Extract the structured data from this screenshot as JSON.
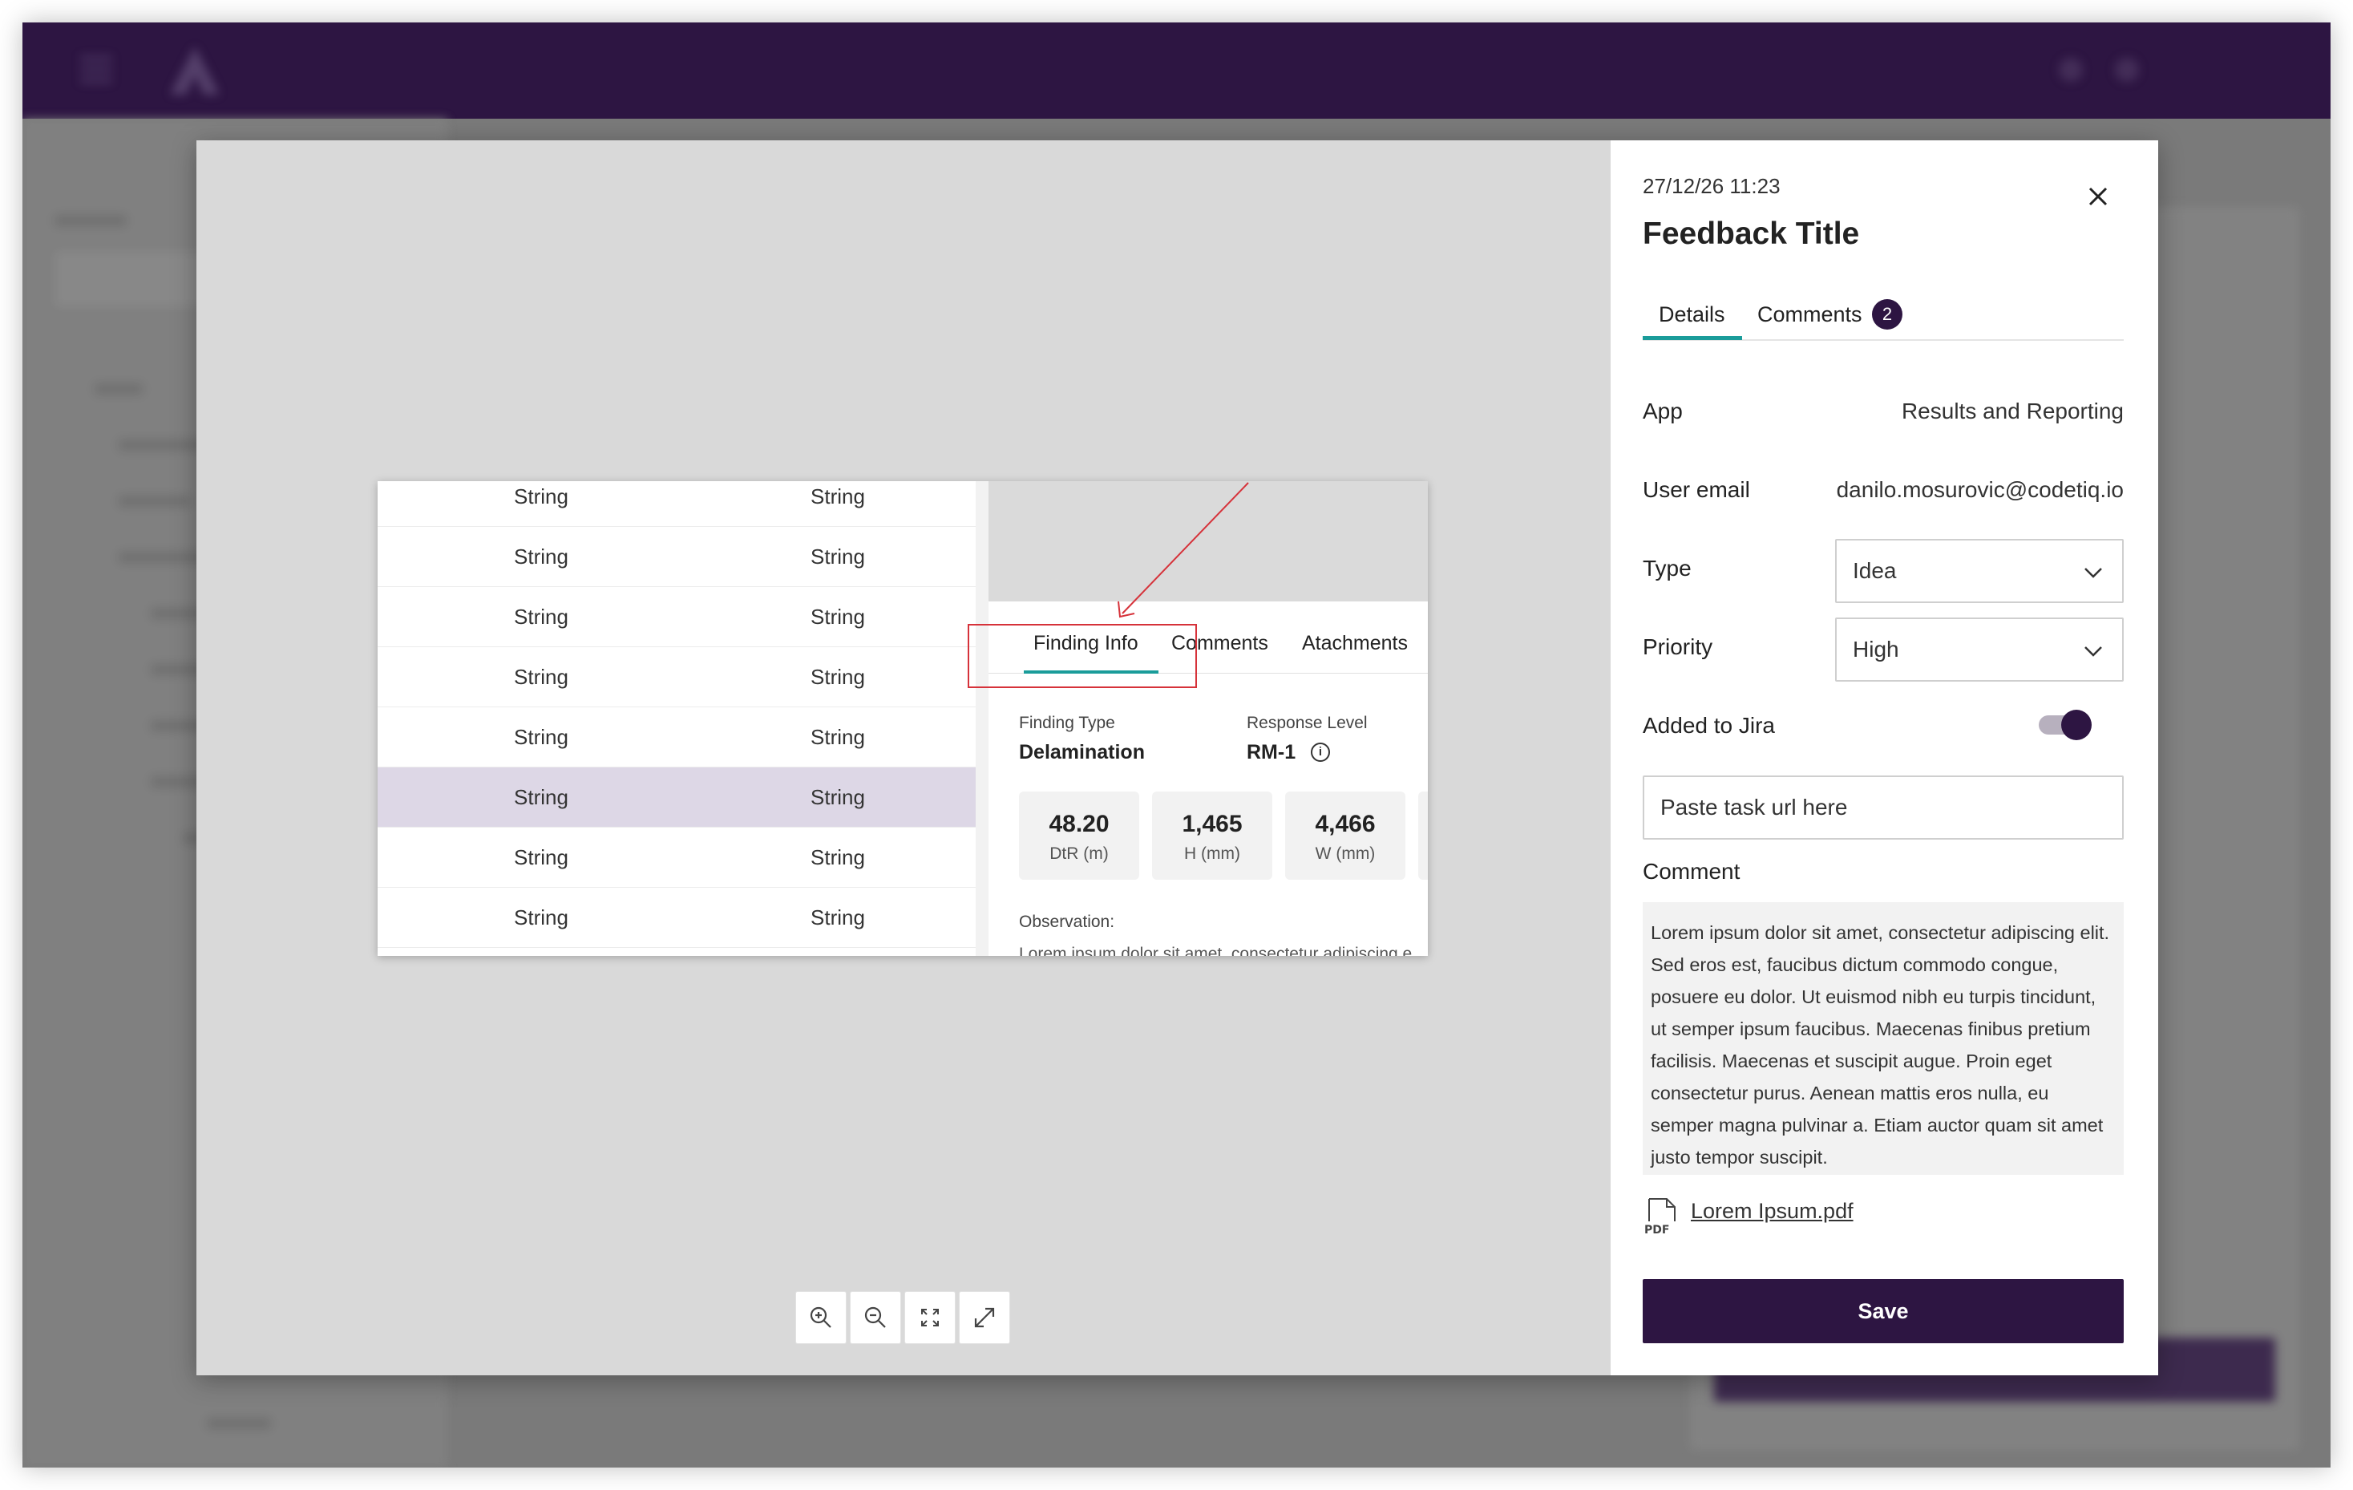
{
  "preview": {
    "rows": [
      {
        "c1": "String",
        "c2": "String",
        "selected": false
      },
      {
        "c1": "String",
        "c2": "String",
        "selected": false
      },
      {
        "c1": "String",
        "c2": "String",
        "selected": false
      },
      {
        "c1": "String",
        "c2": "String",
        "selected": false
      },
      {
        "c1": "String",
        "c2": "String",
        "selected": false
      },
      {
        "c1": "String",
        "c2": "String",
        "selected": true
      },
      {
        "c1": "String",
        "c2": "String",
        "selected": false
      },
      {
        "c1": "String",
        "c2": "String",
        "selected": false
      }
    ],
    "tabs": [
      "Finding Info",
      "Comments",
      "Atachments"
    ],
    "finding_type_label": "Finding Type",
    "finding_type_value": "Delamination",
    "response_level_label": "Response Level",
    "response_level_value": "RM-1",
    "metrics": [
      {
        "value": "48.20",
        "unit": "DtR (m)"
      },
      {
        "value": "1,465",
        "unit": "H (mm)"
      },
      {
        "value": "4,466",
        "unit": "W (mm)"
      }
    ],
    "observation_label": "Observation:",
    "observation_text": "Lorem ipsum dolor sit amet, consectetur adipiscing e",
    "highlight_color": "#d6323a"
  },
  "panel": {
    "date": "27/12/26 11:23",
    "title": "Feedback Title",
    "tab_details": "Details",
    "tab_comments": "Comments",
    "comments_count": "2",
    "app_label": "App",
    "app_value": "Results and Reporting",
    "email_label": "User email",
    "email_value": "danilo.mosurovic@codetiq.io",
    "type_label": "Type",
    "type_value": "Idea",
    "priority_label": "Priority",
    "priority_value": "High",
    "jira_label": "Added to Jira",
    "jira_on": true,
    "task_url_placeholder": "Paste task url here",
    "comment_label": "Comment",
    "comment_text": "Lorem ipsum dolor sit amet, consectetur adipiscing elit. Sed eros est, faucibus dictum commodo congue, posuere eu dolor. Ut euismod nibh eu turpis tincidunt, ut semper ipsum faucibus. Maecenas finibus pretium facilisis. Maecenas et suscipit augue. Proin eget consectetur purus. Aenean mattis eros nulla, eu semper magna pulvinar a. Etiam auctor quam sit amet justo tempor suscipit.",
    "attachment_name": "Lorem Ipsum.pdf",
    "save_label": "Save"
  },
  "colors": {
    "brand": "#2d1542",
    "accent": "#1a9c9a",
    "selected_row": "#ddd7e6"
  },
  "icons": [
    "close-icon",
    "chevron-down-icon",
    "info-icon",
    "pdf-file-icon",
    "zoom-in-icon",
    "zoom-out-icon",
    "fit-screen-icon",
    "expand-icon"
  ]
}
